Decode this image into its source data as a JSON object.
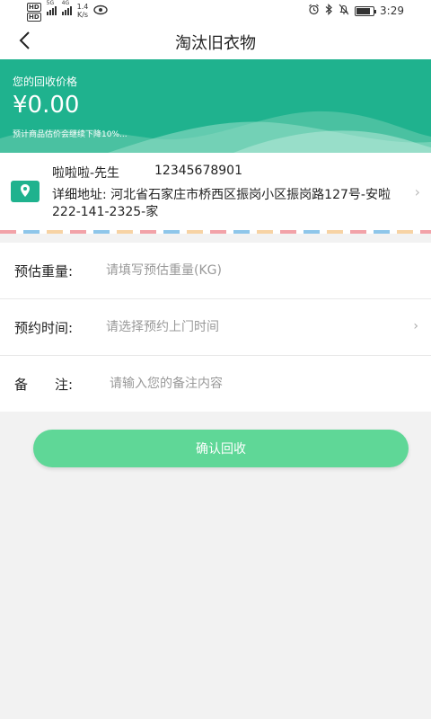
{
  "status_bar": {
    "hd1": "HD",
    "hd2": "HD",
    "net1": "5G",
    "net2": "4G",
    "speed_value": "1.4",
    "speed_unit": "K/s",
    "time": "3:29"
  },
  "header": {
    "title": "淘汰旧衣物"
  },
  "banner": {
    "label": "您的回收价格",
    "price": "¥0.00",
    "note": "预计商品估价会继续下降10%..."
  },
  "address": {
    "name": "啦啦啦-先生",
    "phone": "12345678901",
    "detail": "详细地址: 河北省石家庄市桥西区振岗小区振岗路127号-安啦222-141-2325-家"
  },
  "form": {
    "weight": {
      "label": "预估重量:",
      "placeholder": "请填写预估重量(KG)"
    },
    "time": {
      "label": "预约时间:",
      "placeholder": "请选择预约上门时间"
    },
    "note": {
      "label": "备　　注:",
      "placeholder": "请输入您的备注内容"
    }
  },
  "confirm_label": "确认回收",
  "colors": {
    "banner": "#1fb28e",
    "button": "#5fd797"
  }
}
